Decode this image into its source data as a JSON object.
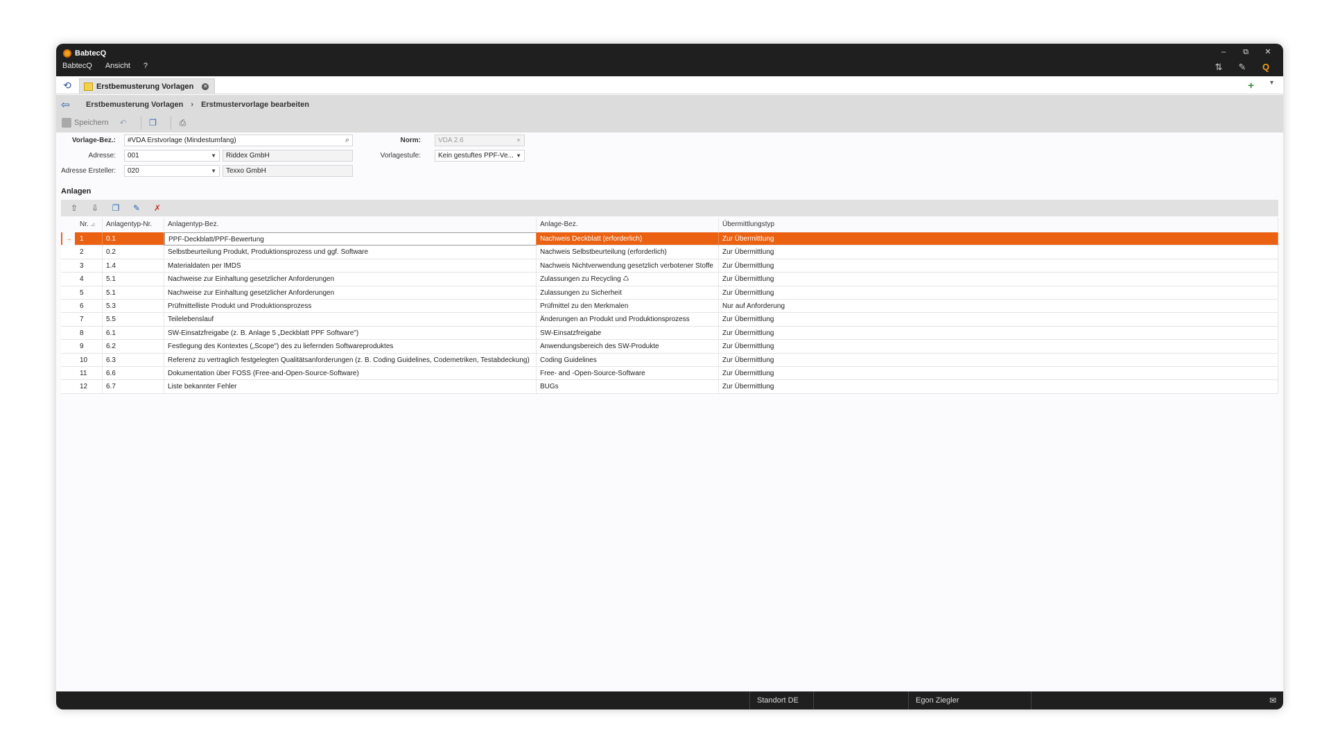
{
  "app": {
    "title": "BabtecQ"
  },
  "menu": [
    "BabtecQ",
    "Ansicht",
    "?"
  ],
  "window_controls": {
    "minimize": "–",
    "restore": "⧉",
    "close": "✕"
  },
  "tabs": [
    {
      "label": "Erstbemusterung Vorlagen",
      "active": true
    }
  ],
  "tab_actions": {
    "add": "+",
    "menu": "▾"
  },
  "breadcrumb": [
    "Erstbemusterung Vorlagen",
    "Erstmustervorlage bearbeiten"
  ],
  "toolbar": {
    "save_label": "Speichern"
  },
  "form": {
    "vorlage_label": "Vorlage-Bez.:",
    "vorlage_value": "#VDA Erstvorlage (Mindestumfang)",
    "adresse_label": "Adresse:",
    "adresse_code": "001",
    "adresse_name": "Riddex GmbH",
    "ersteller_label": "Adresse Ersteller:",
    "ersteller_code": "020",
    "ersteller_name": "Texxo GmbH",
    "norm_label": "Norm:",
    "norm_value": "VDA 2.6",
    "stufe_label": "Vorlagestufe:",
    "stufe_value": "Kein gestuftes PPF-Ve..."
  },
  "section": {
    "title": "Anlagen"
  },
  "grid": {
    "columns": [
      "Nr.",
      "Anlagentyp-Nr.",
      "Anlagentyp-Bez.",
      "Anlage-Bez.",
      "Übermittlungstyp"
    ],
    "selected_index": 0,
    "rows": [
      {
        "nr": "1",
        "typ_nr": "0.1",
        "typ_bez": "PPF-Deckblatt/PPF-Bewertung",
        "anlage": "Nachweis Deckblatt (erforderlich)",
        "uebermittlung": "Zur Übermittlung"
      },
      {
        "nr": "2",
        "typ_nr": "0.2",
        "typ_bez": "Selbstbeurteilung Produkt, Produktionsprozess und ggf. Software",
        "anlage": "Nachweis Selbstbeurteilung (erforderlich)",
        "uebermittlung": "Zur Übermittlung"
      },
      {
        "nr": "3",
        "typ_nr": "1.4",
        "typ_bez": "Materialdaten per IMDS",
        "anlage": "Nachweis Nichtverwendung gesetzlich verbotener Stoffe",
        "uebermittlung": "Zur Übermittlung"
      },
      {
        "nr": "4",
        "typ_nr": "5.1",
        "typ_bez": "Nachweise zur Einhaltung gesetzlicher Anforderungen",
        "anlage": "Zulassungen zu Recycling ♺",
        "uebermittlung": "Zur Übermittlung"
      },
      {
        "nr": "5",
        "typ_nr": "5.1",
        "typ_bez": "Nachweise zur Einhaltung gesetzlicher Anforderungen",
        "anlage": "Zulassungen zu Sicherheit",
        "uebermittlung": "Zur Übermittlung"
      },
      {
        "nr": "6",
        "typ_nr": "5.3",
        "typ_bez": "Prüfmittelliste Produkt und Produktionsprozess",
        "anlage": "Prüfmittel zu den Merkmalen",
        "uebermittlung": "Nur auf Anforderung"
      },
      {
        "nr": "7",
        "typ_nr": "5.5",
        "typ_bez": "Teilelebenslauf",
        "anlage": "Änderungen an Produkt und Produktionsprozess",
        "uebermittlung": "Zur Übermittlung"
      },
      {
        "nr": "8",
        "typ_nr": "6.1",
        "typ_bez": "SW-Einsatzfreigabe (z. B. Anlage 5 „Deckblatt PPF Software\")",
        "anlage": "SW-Einsatzfreigabe",
        "uebermittlung": "Zur Übermittlung"
      },
      {
        "nr": "9",
        "typ_nr": "6.2",
        "typ_bez": "Festlegung des Kontextes („Scope\") des zu liefernden Softwareproduktes",
        "anlage": "Anwendungsbereich des SW-Produkte",
        "uebermittlung": "Zur Übermittlung"
      },
      {
        "nr": "10",
        "typ_nr": "6.3",
        "typ_bez": "Referenz zu vertraglich festgelegten Qualitätsanforderungen (z. B. Coding Guidelines, Codemetriken, Testabdeckung)",
        "anlage": "Coding Guidelines",
        "uebermittlung": "Zur Übermittlung"
      },
      {
        "nr": "11",
        "typ_nr": "6.6",
        "typ_bez": "Dokumentation über FOSS (Free-and-Open-Source-Software)",
        "anlage": "Free- and -Open-Source-Software",
        "uebermittlung": "Zur Übermittlung"
      },
      {
        "nr": "12",
        "typ_nr": "6.7",
        "typ_bez": "Liste bekannter Fehler",
        "anlage": "BUGs",
        "uebermittlung": "Zur Übermittlung"
      }
    ]
  },
  "status": {
    "site": "Standort DE",
    "user": "Egon Ziegler"
  },
  "colors": {
    "selection": "#ea6112",
    "titlebar": "#1f1f1f",
    "accent_blue": "#1e5aa8"
  },
  "icons": [
    "app-logo-icon",
    "home-icon",
    "tab-doc-icon",
    "tab-close-icon",
    "back-arrow-icon",
    "save-icon",
    "undo-icon",
    "new-doc-icon",
    "print-icon",
    "search-icon",
    "move-up-icon",
    "move-down-icon",
    "add-row-icon",
    "edit-row-icon",
    "delete-row-icon",
    "mail-icon"
  ]
}
